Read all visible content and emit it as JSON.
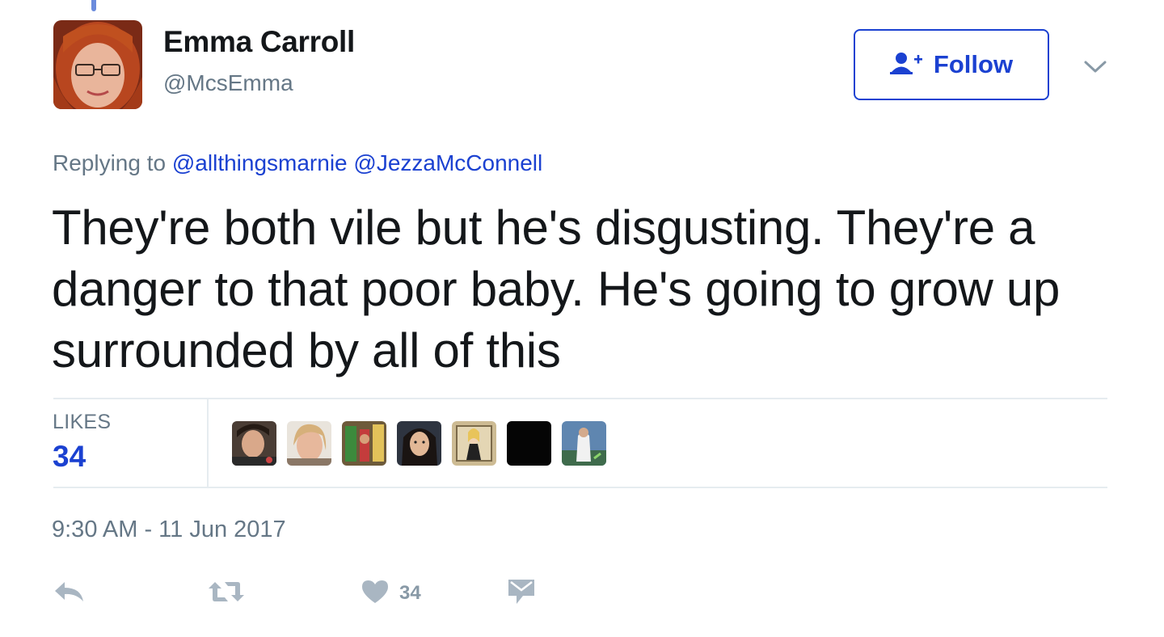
{
  "header": {
    "display_name": "Emma Carroll",
    "screen_name": "@McsEmma",
    "follow_label": "Follow"
  },
  "reply": {
    "prefix": "Replying to",
    "mentions": [
      "@allthingsmarnie",
      "@JezzaMcConnell"
    ]
  },
  "tweet": {
    "text": "They're both vile but he's disgusting. They're a danger to that poor baby. He's going to grow up surrounded by all of this"
  },
  "stats": {
    "likes_label": "LIKES",
    "likes_count": "34"
  },
  "timestamp": "9:30 AM - 11 Jun 2017",
  "actions": {
    "like_count": "34"
  },
  "colors": {
    "accent": "#1b41d1",
    "secondary_text": "#657786",
    "icon_gray": "#a9b6c2",
    "divider": "#e6ecf0"
  },
  "icons": [
    "follow-person-icon",
    "chevron-down-icon",
    "reply-icon",
    "retweet-icon",
    "heart-icon",
    "direct-message-icon"
  ]
}
